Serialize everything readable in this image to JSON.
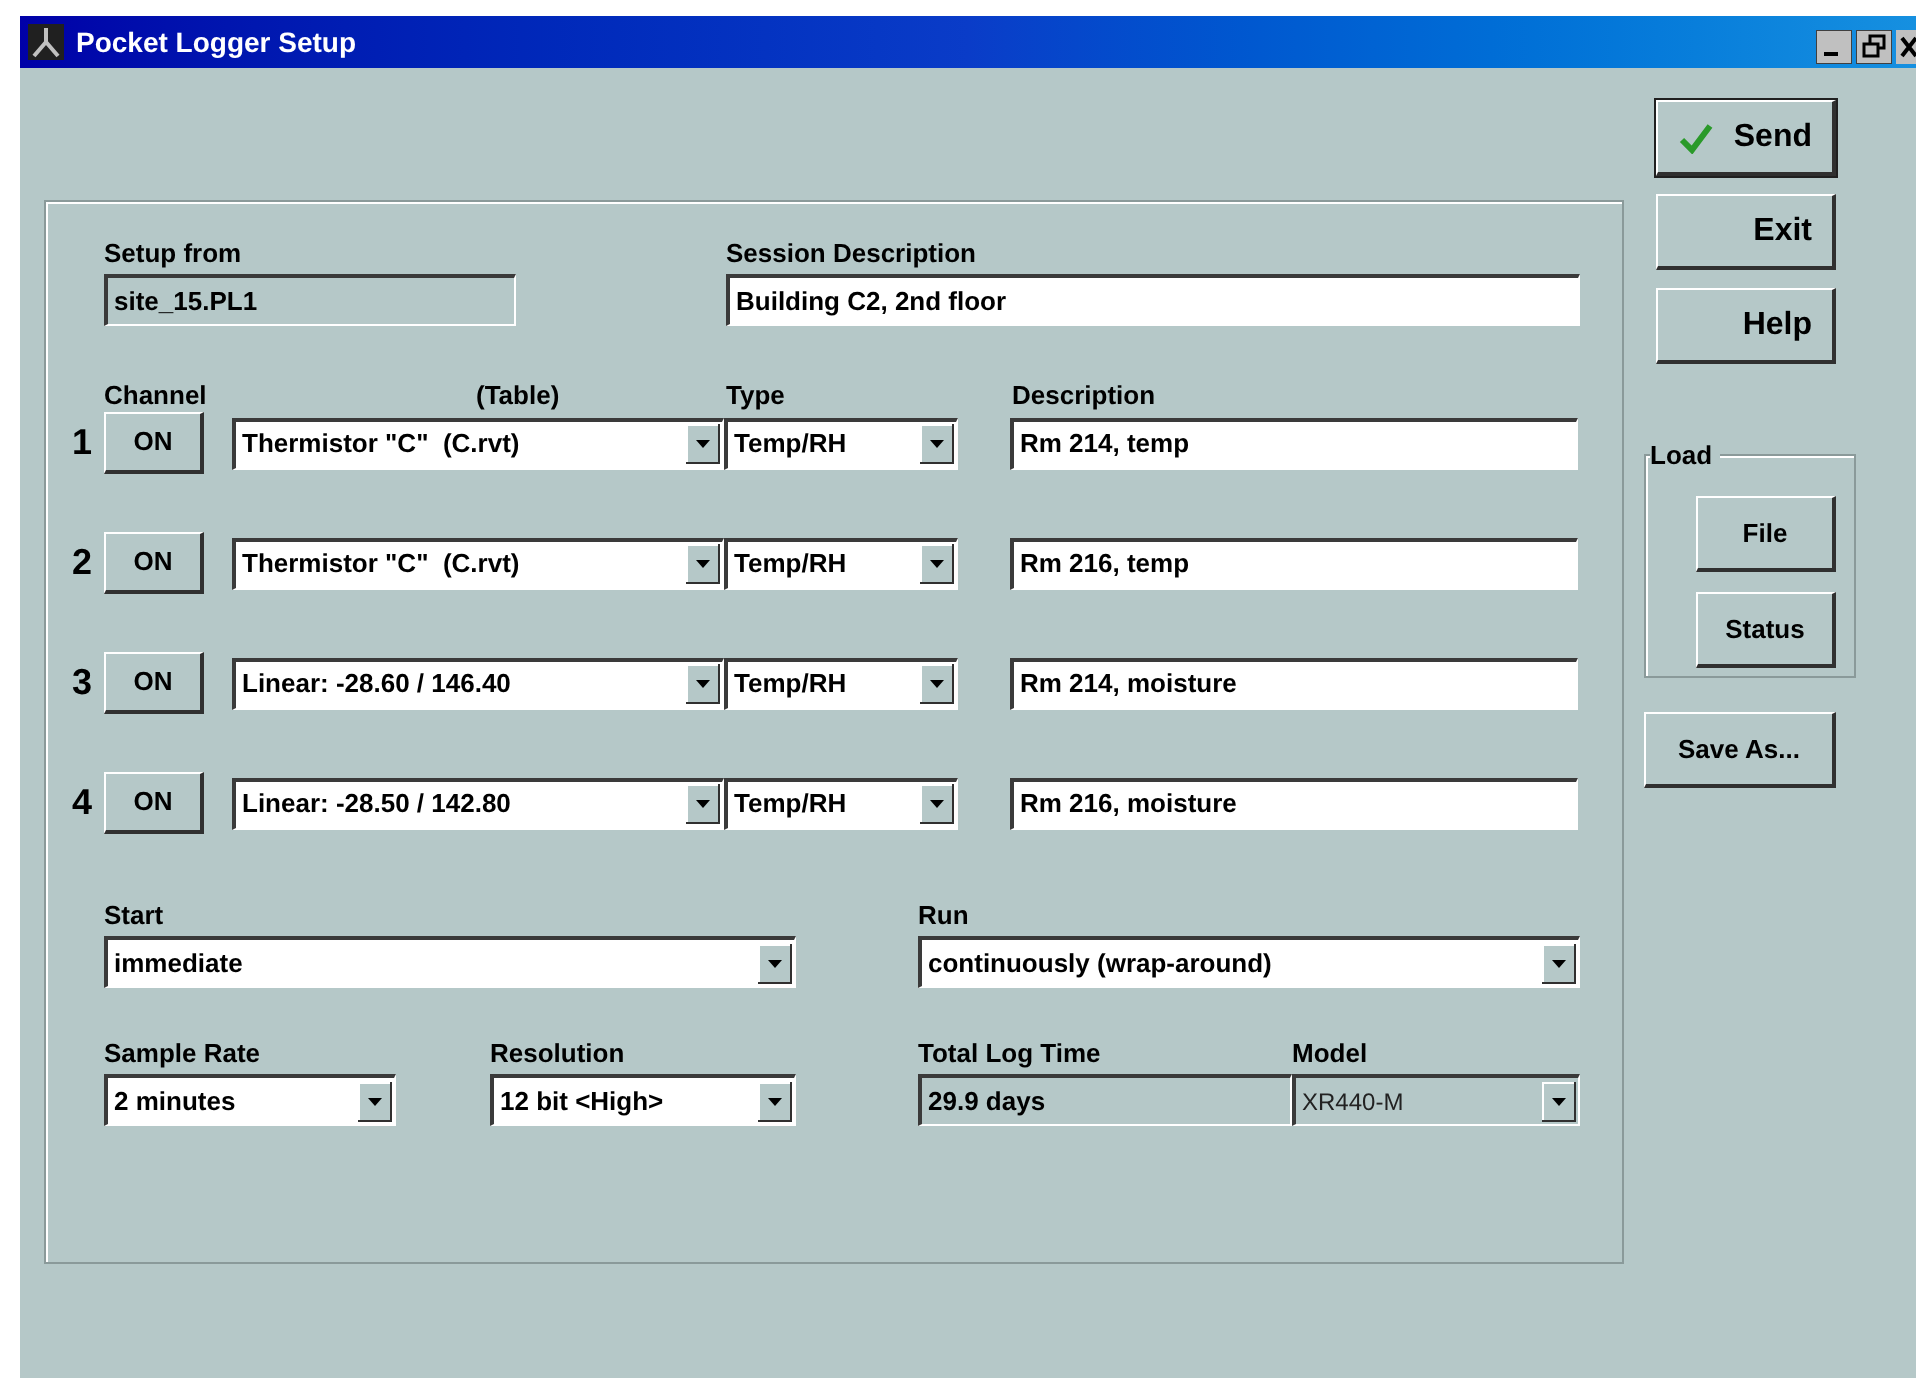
{
  "window": {
    "title": "Pocket Logger Setup"
  },
  "setup_from": {
    "label": "Setup from",
    "value": "site_15.PL1"
  },
  "session_description": {
    "label": "Session Description",
    "value": "Building C2, 2nd floor"
  },
  "channel_headers": {
    "channel": "Channel",
    "table": "(Table)",
    "type": "Type",
    "description": "Description"
  },
  "channels": [
    {
      "number": "1",
      "button": "ON",
      "table": "Thermistor \"C\"  (C.rvt)",
      "type": "Temp/RH",
      "description": "Rm 214, temp"
    },
    {
      "number": "2",
      "button": "ON",
      "table": "Thermistor \"C\"  (C.rvt)",
      "type": "Temp/RH",
      "description": "Rm 216, temp"
    },
    {
      "number": "3",
      "button": "ON",
      "table": "Linear: -28.60 / 146.40",
      "type": "Temp/RH",
      "description": "Rm 214, moisture"
    },
    {
      "number": "4",
      "button": "ON",
      "table": "Linear: -28.50 / 142.80",
      "type": "Temp/RH",
      "description": "Rm 216, moisture"
    }
  ],
  "start": {
    "label": "Start",
    "value": "immediate"
  },
  "run": {
    "label": "Run",
    "value": "continuously (wrap-around)"
  },
  "sample_rate": {
    "label": "Sample Rate",
    "value": "2 minutes"
  },
  "resolution": {
    "label": "Resolution",
    "value": "12 bit <High>"
  },
  "total_log_time": {
    "label": "Total Log Time",
    "value": "29.9 days",
    "read_only": true
  },
  "model": {
    "label": "Model",
    "value": "XR440-M",
    "disabled": true
  },
  "side_buttons": [
    {
      "kind": "default",
      "label": "Send"
    },
    {
      "kind": "plain",
      "label": "Exit"
    },
    {
      "kind": "plain",
      "label": "Help"
    }
  ],
  "load_group": {
    "label": "Load",
    "buttons": [
      {
        "label": "File"
      },
      {
        "label": "Status"
      }
    ]
  },
  "save_as": {
    "label": "Save As..."
  }
}
